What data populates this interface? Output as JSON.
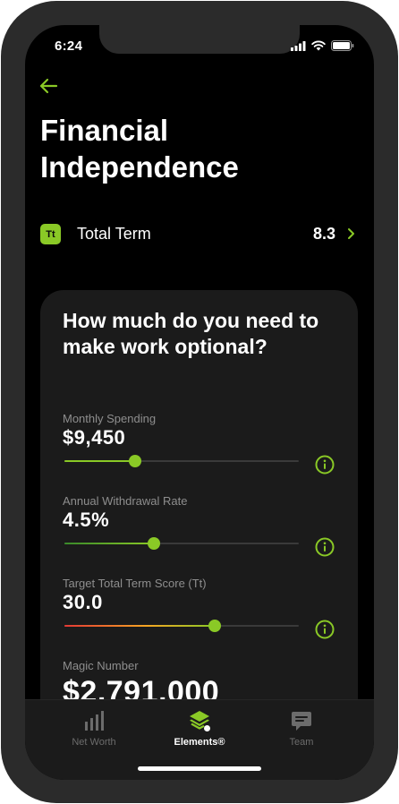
{
  "status_bar": {
    "time": "6:24"
  },
  "header": {
    "title": "Financial Independence"
  },
  "term_row": {
    "badge": "Tt",
    "label": "Total Term",
    "value": "8.3"
  },
  "card": {
    "question": "How much do you need to make work optional?",
    "fields": [
      {
        "label": "Monthly Spending",
        "value": "$9,450",
        "slider_fraction": 0.3
      },
      {
        "label": "Annual Withdrawal Rate",
        "value": "4.5%",
        "slider_fraction": 0.38
      },
      {
        "label": "Target Total Term Score (Tt)",
        "value": "30.0",
        "slider_fraction": 0.64
      },
      {
        "label": "Magic Number",
        "value": "$2,791,000"
      }
    ]
  },
  "tab_bar": {
    "tabs": [
      {
        "label": "Net Worth",
        "icon": "bar-chart-icon",
        "active": false
      },
      {
        "label": "Elements®",
        "icon": "layers-icon",
        "active": true
      },
      {
        "label": "Team",
        "icon": "chat-bubble-icon",
        "active": false
      }
    ]
  },
  "colors": {
    "accent": "#8ac926",
    "background": "#000000",
    "card": "#1b1b1b",
    "muted_text": "#8e8e8e",
    "track": "#3a3a3a",
    "gradient_start": "#e53935",
    "gradient_mid": "#f5a623"
  }
}
